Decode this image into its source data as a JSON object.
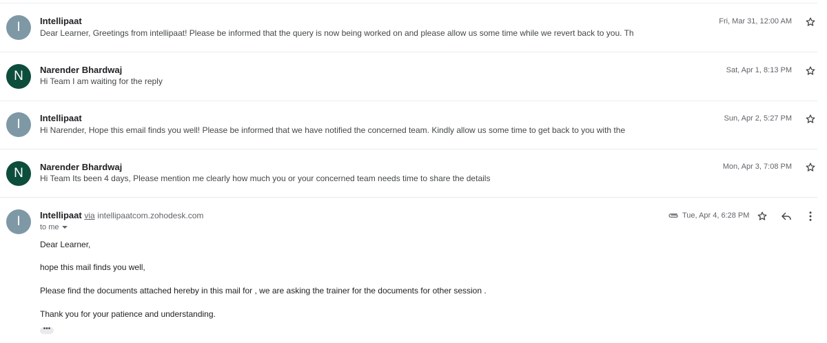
{
  "messages": [
    {
      "avatar_letter": "I",
      "sender": "Intellipaat",
      "snippet": "Dear Learner, Greetings from intellipaat! Please be informed that the query is now being worked on and please allow us some time while we revert back to you. Th",
      "date": "Fri, Mar 31, 12:00 AM"
    },
    {
      "avatar_letter": "N",
      "sender": "Narender Bhardwaj",
      "snippet": "Hi Team I am waiting for the reply",
      "date": "Sat, Apr 1, 8:13 PM"
    },
    {
      "avatar_letter": "I",
      "sender": "Intellipaat",
      "snippet": "Hi Narender, Hope this email finds you well! Please be informed that we have notified the concerned team. Kindly allow us some time to get back to you with the",
      "date": "Sun, Apr 2, 5:27 PM"
    },
    {
      "avatar_letter": "N",
      "sender": "Narender Bhardwaj",
      "snippet": "Hi Team Its been 4 days, Please mention me clearly how much you or your concerned team needs time to share the details",
      "date": "Mon, Apr 3, 7:08 PM"
    }
  ],
  "open_message": {
    "avatar_letter": "I",
    "sender": "Intellipaat",
    "via_label": "via",
    "via_domain": "intellipaatcom.zohodesk.com",
    "recipient": "to me",
    "date": "Tue, Apr 4, 6:28 PM",
    "body": [
      "Dear Learner,",
      "hope this mail finds you well,",
      "Please find the documents attached hereby in this mail for , we are asking the trainer for the documents for other session .",
      "Thank you for your patience and understanding."
    ],
    "trimmed_label": "•••"
  },
  "icons": {
    "star": "star-outline-icon",
    "reply": "reply-icon",
    "more": "more-vert-icon",
    "attachment": "paperclip-icon"
  },
  "colors": {
    "avatar_grey": "#7f98a6",
    "avatar_green": "#0d4d3c",
    "text_primary": "#202124",
    "text_secondary": "#5f6368"
  }
}
